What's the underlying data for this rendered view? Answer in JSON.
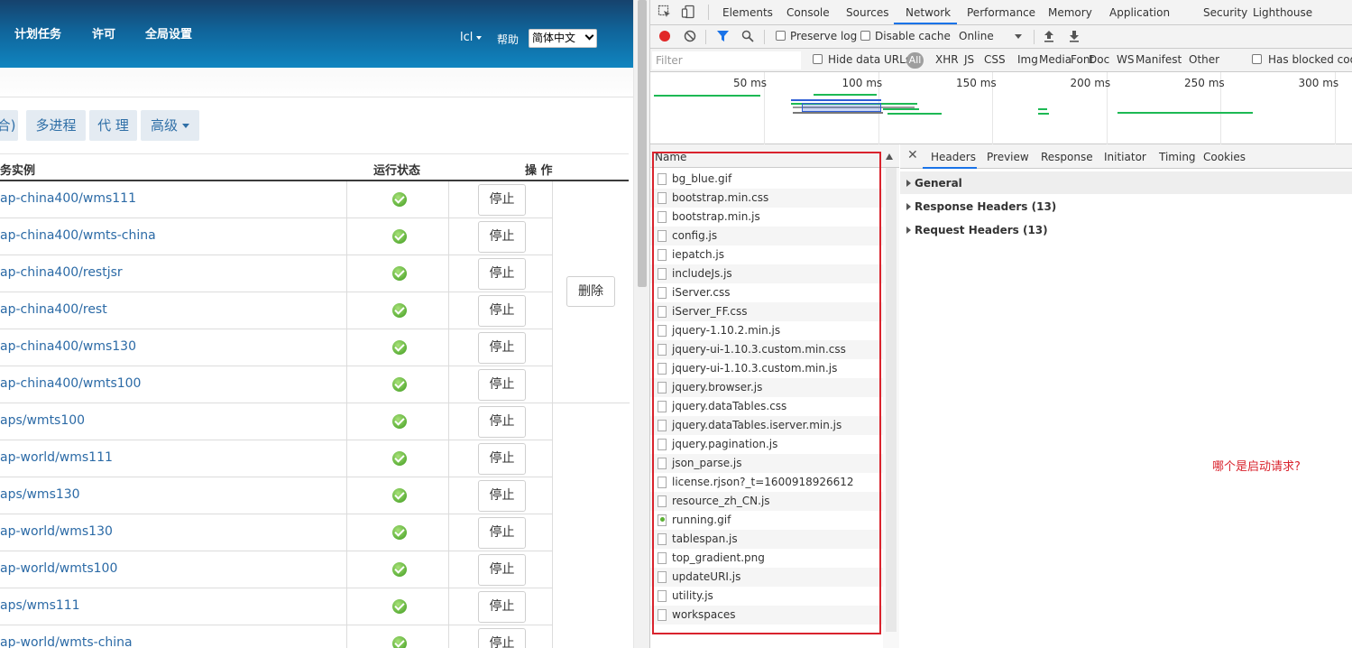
{
  "app": {
    "nav": [
      "计划任务",
      "许可",
      "全局设置"
    ],
    "user": "lcl",
    "help": "帮助",
    "language": "简体中文",
    "tabs": [
      "合)",
      "多进程",
      "代 理",
      "高级"
    ],
    "table_headers": {
      "instance": "务实例",
      "status": "运行状态",
      "actions": "操 作"
    },
    "rows": [
      "ap-china400/wms111",
      "ap-china400/wmts-china",
      "ap-china400/restjsr",
      "ap-china400/rest",
      "ap-china400/wms130",
      "ap-china400/wmts100",
      "aps/wmts100",
      "ap-world/wms111",
      "aps/wms130",
      "ap-world/wms130",
      "ap-world/wmts100",
      "aps/wms111",
      "ap-world/wmts-china"
    ],
    "stop_label": "停止",
    "delete_label": "删除"
  },
  "devtools": {
    "tabs": [
      "Elements",
      "Console",
      "Sources",
      "Network",
      "Performance",
      "Memory",
      "Application",
      "Security",
      "Lighthouse"
    ],
    "active_tab": "Network",
    "toolbar": {
      "preserve_log": "Preserve log",
      "disable_cache": "Disable cache",
      "throttle": "Online"
    },
    "filter": {
      "placeholder": "Filter",
      "hide_data_urls": "Hide data URLs",
      "all": "All",
      "types": [
        "XHR",
        "JS",
        "CSS",
        "Img",
        "Media",
        "Font",
        "Doc",
        "WS",
        "Manifest",
        "Other"
      ],
      "blocked_cookies": "Has blocked cookies"
    },
    "timeline_ticks": [
      "50 ms",
      "100 ms",
      "150 ms",
      "200 ms",
      "250 ms",
      "300 ms"
    ],
    "name_header": "Name",
    "requests": [
      "bg_blue.gif",
      "bootstrap.min.css",
      "bootstrap.min.js",
      "config.js",
      "iepatch.js",
      "includeJs.js",
      "iServer.css",
      "iServer_FF.css",
      "jquery-1.10.2.min.js",
      "jquery-ui-1.10.3.custom.min.css",
      "jquery-ui-1.10.3.custom.min.js",
      "jquery.browser.js",
      "jquery.dataTables.css",
      "jquery.dataTables.iserver.min.js",
      "jquery.pagination.js",
      "json_parse.js",
      "license.rjson?_t=1600918926612",
      "resource_zh_CN.js",
      "running.gif",
      "tablespan.js",
      "top_gradient.png",
      "updateURI.js",
      "utility.js",
      "workspaces"
    ],
    "detail_tabs": [
      "Headers",
      "Preview",
      "Response",
      "Initiator",
      "Timing",
      "Cookies"
    ],
    "sections": [
      "General",
      "Response Headers (13)",
      "Request Headers (13)"
    ],
    "annotation": "哪个是启动请求?",
    "colors": {
      "accent": "#1a73e8",
      "annotation": "#d9232d"
    }
  }
}
